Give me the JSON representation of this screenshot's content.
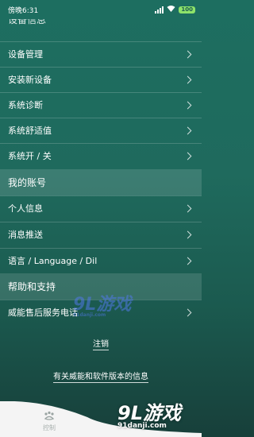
{
  "status_bar": {
    "carrier": "傍晚6:31",
    "battery": "100"
  },
  "partial_row": {
    "label": "设备信息"
  },
  "rows": [
    {
      "label": "设备管理"
    },
    {
      "label": "安装新设备"
    },
    {
      "label": "系统诊断"
    },
    {
      "label": "系统舒适值"
    },
    {
      "label": "系统开 / 关"
    }
  ],
  "section_account": {
    "title": "我的账号"
  },
  "account_rows": [
    {
      "label": "个人信息"
    },
    {
      "label": "消息推送"
    },
    {
      "label": "语言 / Language / Dil"
    }
  ],
  "section_help": {
    "title": "帮助和支持"
  },
  "help_rows": [
    {
      "label": "威能售后服务电话"
    }
  ],
  "logout": "注销",
  "about": "有关威能和软件版本的信息",
  "bottom_nav": {
    "tab_label": "控制"
  },
  "watermark": {
    "main": "9L游戏",
    "sub": "91danji.com",
    "corner": "9L游戏",
    "corner_sub": "91danji.com"
  }
}
